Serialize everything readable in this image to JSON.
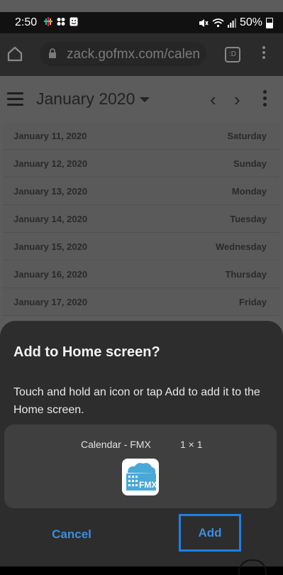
{
  "status_bar": {
    "time": "2:50",
    "battery": "50%"
  },
  "browser": {
    "url": "zack.gofmx.com/calen",
    "tabs_count": ":D"
  },
  "calendar": {
    "month_title": "January 2020",
    "days": [
      {
        "date": "January 11, 2020",
        "weekday": "Saturday"
      },
      {
        "date": "January 12, 2020",
        "weekday": "Sunday"
      },
      {
        "date": "January 13, 2020",
        "weekday": "Monday"
      },
      {
        "date": "January 14, 2020",
        "weekday": "Tuesday"
      },
      {
        "date": "January 15, 2020",
        "weekday": "Wednesday"
      },
      {
        "date": "January 16, 2020",
        "weekday": "Thursday"
      },
      {
        "date": "January 17, 2020",
        "weekday": "Friday"
      }
    ]
  },
  "dialog": {
    "title": "Add to Home screen?",
    "body": "Touch and hold an icon or tap Add to add it to the Home screen.",
    "app_name": "Calendar - FMX",
    "widget_size": "1 × 1",
    "icon_text": "FMX",
    "cancel_label": "Cancel",
    "add_label": "Add"
  },
  "colors": {
    "accent": "#3b8de0",
    "highlight_border": "#1e7fe6",
    "icon_blue": "#4aa8d8"
  },
  "icons": [
    "home-icon",
    "lock-icon",
    "tabs-icon",
    "menu-icon",
    "hamburger-icon",
    "caret-down-icon",
    "chevron-left-icon",
    "chevron-right-icon",
    "more-vert-icon",
    "app-icon"
  ]
}
